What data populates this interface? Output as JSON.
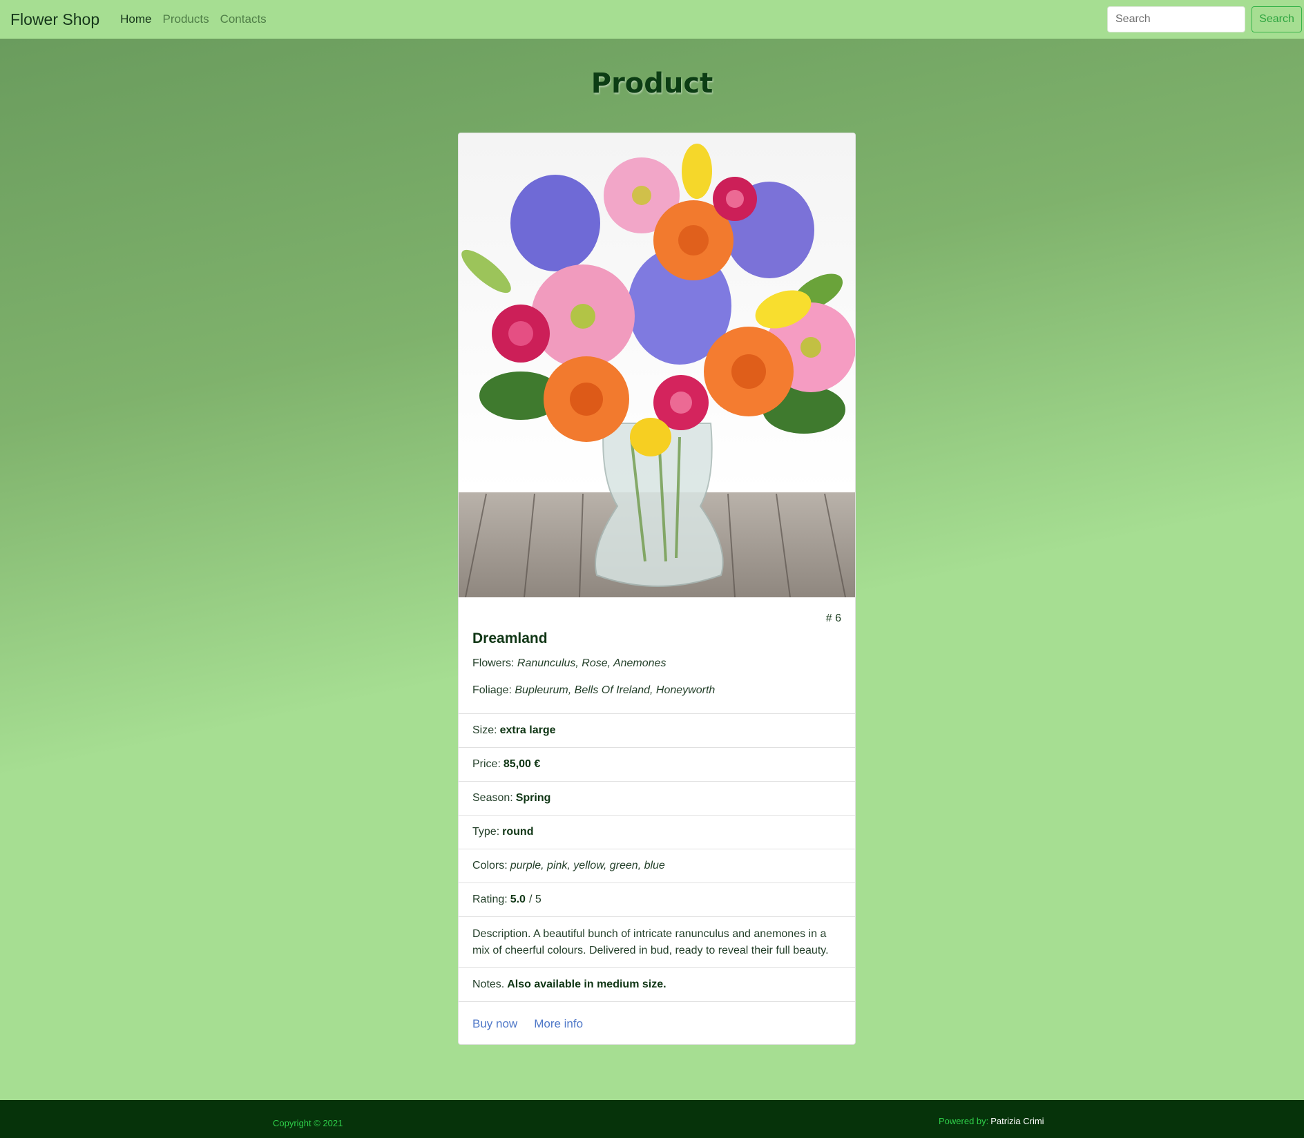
{
  "navbar": {
    "brand": "Flower Shop",
    "links": [
      {
        "label": "Home",
        "active": true
      },
      {
        "label": "Products",
        "active": false
      },
      {
        "label": "Contacts",
        "active": false
      }
    ],
    "search_placeholder": "Search",
    "search_button": "Search"
  },
  "page": {
    "title": "Product"
  },
  "product": {
    "id": "# 6",
    "name": "Dreamland",
    "flowers_label": "Flowers:",
    "flowers": "Ranunculus, Rose, Anemones",
    "foliage_label": "Foliage:",
    "foliage": "Bupleurum, Bells Of Ireland, Honeyworth",
    "size_label": "Size:",
    "size": "extra large",
    "price_label": "Price:",
    "price": "85,00 €",
    "season_label": "Season:",
    "season": "Spring",
    "type_label": "Type:",
    "type": "round",
    "colors_label": "Colors:",
    "colors": "purple, pink, yellow, green, blue",
    "rating_label": "Rating:",
    "rating": "5.0",
    "rating_max": "/ 5",
    "description_label": "Description.",
    "description": "A beautiful bunch of intricate ranunculus and anemones in a mix of cheerful colours. Delivered in bud, ready to reveal their full beauty.",
    "notes_label": "Notes.",
    "notes": "Also available in medium size.",
    "buy_link": "Buy now",
    "info_link": "More info"
  },
  "footer": {
    "copyright": "Copyright © 2021",
    "powered_label": "Powered by:",
    "author": "Patrizia Crimi"
  },
  "colors": {
    "navbar_bg": "#a6de92",
    "title": "#0c3d14",
    "link": "#4f78c8",
    "footer_bg": "#06330a",
    "footer_text": "#2fd04a"
  }
}
